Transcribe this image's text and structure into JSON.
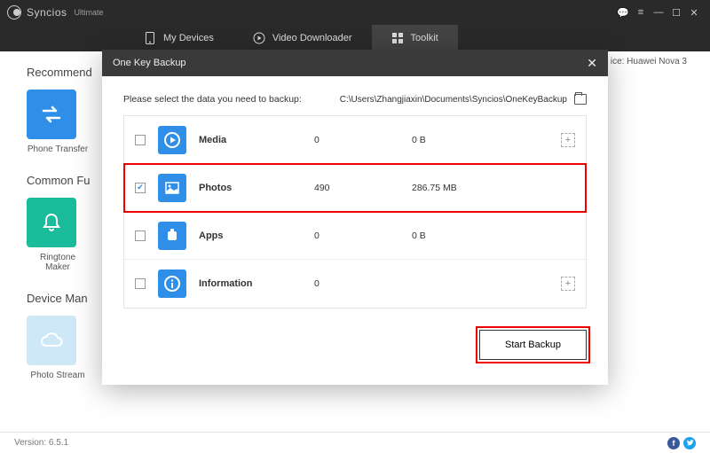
{
  "app": {
    "brand": "Syncios",
    "edition": "Ultimate"
  },
  "nav": {
    "devices": "My Devices",
    "video": "Video Downloader",
    "toolkit": "Toolkit"
  },
  "device_info": "ice: Huawei Nova 3",
  "sidebar": {
    "recommended": "Recommend",
    "phone_transfer": "Phone Transfer",
    "common": "Common Fu",
    "ringtone": "Ringtone Maker",
    "device_man": "Device Man",
    "photo_stream": "Photo Stream"
  },
  "modal": {
    "title": "One Key Backup",
    "instruction": "Please select the data you need to backup:",
    "path": "C:\\Users\\Zhangjiaxin\\Documents\\Syncios\\OneKeyBackup",
    "rows": [
      {
        "name": "Media",
        "count": "0",
        "size": "0 B",
        "checked": false,
        "expandable": true
      },
      {
        "name": "Photos",
        "count": "490",
        "size": "286.75 MB",
        "checked": true,
        "expandable": false
      },
      {
        "name": "Apps",
        "count": "0",
        "size": "0 B",
        "checked": false,
        "expandable": false
      },
      {
        "name": "Information",
        "count": "0",
        "size": "",
        "checked": false,
        "expandable": true
      }
    ],
    "start_label": "Start Backup"
  },
  "footer": {
    "version": "Version: 6.5.1"
  }
}
